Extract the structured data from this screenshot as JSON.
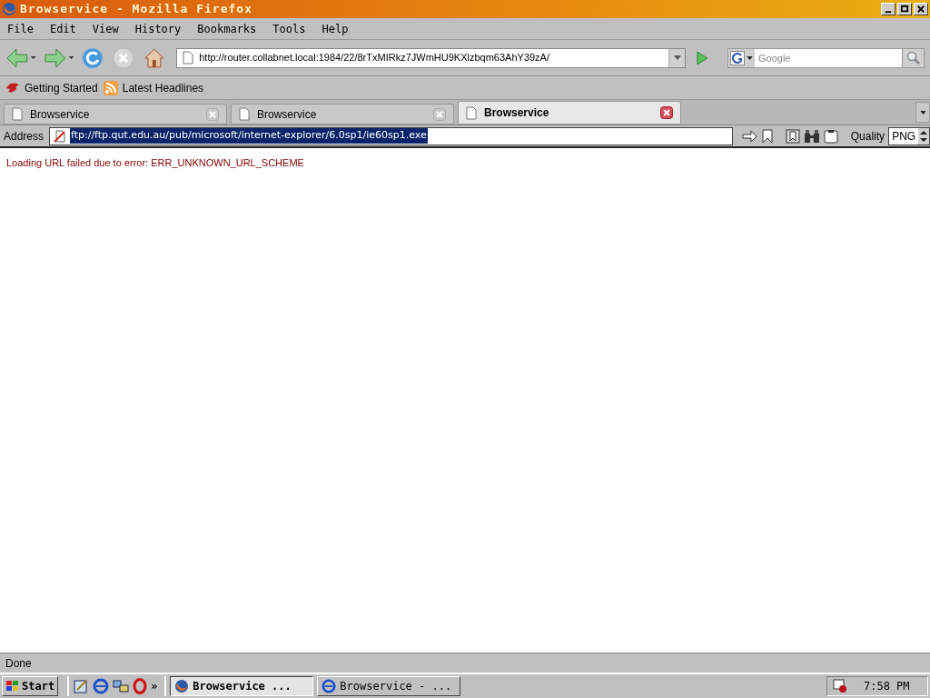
{
  "window": {
    "title": "Browservice - Mozilla Firefox"
  },
  "menu": [
    "File",
    "Edit",
    "View",
    "History",
    "Bookmarks",
    "Tools",
    "Help"
  ],
  "navigation": {
    "url": "http://router.collabnet.local:1984/22/8rTxMIRkz7JWmHU9KXlzbqm63AhY39zA/",
    "search_placeholder": "Google"
  },
  "bookmarks": [
    {
      "label": "Getting Started",
      "kind": "page"
    },
    {
      "label": "Latest Headlines",
      "kind": "feed"
    }
  ],
  "tabs": [
    {
      "label": "Browservice",
      "selected": false
    },
    {
      "label": "Browservice",
      "selected": false
    },
    {
      "label": "Browservice",
      "selected": true
    }
  ],
  "address_bar": {
    "label": "Address",
    "url": "ftp://ftp.qut.edu.au/pub/microsoft/internet-explorer/6.0sp1/ie60sp1.exe",
    "selected": true
  },
  "quality": {
    "label": "Quality",
    "value": "PNG"
  },
  "content": {
    "error": "Loading URL failed due to error: ERR_UNKNOWN_URL_SCHEME"
  },
  "status_bar": "Done",
  "taskbar": {
    "start": "Start",
    "more": "»",
    "tasks": [
      {
        "label": "Browservice ...",
        "kind": "firefox",
        "selected": true
      },
      {
        "label": "Browservice - ...",
        "kind": "ie",
        "selected": false
      }
    ],
    "clock": "7:58 PM"
  }
}
